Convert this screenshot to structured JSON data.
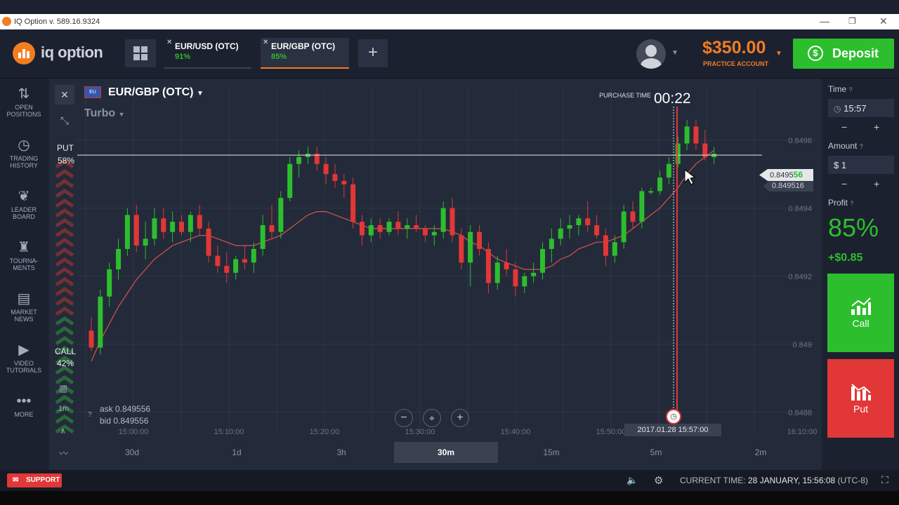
{
  "window": {
    "title": "IQ Option v. 589.16.9324",
    "minimize": "—",
    "restore": "❐",
    "close": "✕"
  },
  "header": {
    "logo_text": "iq option",
    "tabs": [
      {
        "name": "EUR/USD (OTC)",
        "pct": "91%",
        "close": "✕"
      },
      {
        "name": "EUR/GBP (OTC)",
        "pct": "85%",
        "close": "✕"
      }
    ],
    "add_tab": "+",
    "balance": "$350.00",
    "account_type": "PRACTICE ACCOUNT",
    "deposit": "Deposit"
  },
  "nav": [
    {
      "label1": "OPEN",
      "label2": "POSITIONS",
      "icon": "sort-arrows-icon"
    },
    {
      "label1": "TRADING",
      "label2": "HISTORY",
      "icon": "history-icon"
    },
    {
      "label1": "LEADER",
      "label2": "BOARD",
      "icon": "leader-icon"
    },
    {
      "label1": "TOURNA-",
      "label2": "MENTS",
      "icon": "trophy-icon"
    },
    {
      "label1": "MARKET",
      "label2": "NEWS",
      "icon": "news-icon"
    },
    {
      "label1": "VIDEO",
      "label2": "TUTORIALS",
      "icon": "play-icon"
    },
    {
      "label1": "MORE",
      "label2": "",
      "icon": "dots-icon"
    }
  ],
  "chart": {
    "asset": "EUR/GBP (OTC)",
    "mode": "Turbo",
    "purchase_label": "PURCHASE TIME",
    "purchase_countdown": "00:22",
    "put_label": "PUT",
    "put_pct": "58%",
    "call_label": "CALL",
    "call_pct": "42%",
    "interval": "1m",
    "ask": "ask 0.849556",
    "bid": "bid 0.849556",
    "price_tag_main": "0.8495",
    "price_tag_hi": "56",
    "price_tag_prev": "0.849516",
    "expiry_label": "2017.01.28 15:57:00",
    "time_axis": [
      "15:00:00",
      "15:10:00",
      "15:20:00",
      "15:30:00",
      "15:40:00",
      "15:50:00",
      "16:00:00",
      "16:10:00"
    ],
    "price_axis": [
      "0.8496",
      "0.8494",
      "0.8492",
      "0.849",
      "0.8488"
    ],
    "timeframes": [
      "30d",
      "1d",
      "3h",
      "30m",
      "15m",
      "5m",
      "2m"
    ],
    "active_timeframe": "30m"
  },
  "chart_data": {
    "type": "candlestick",
    "ylim": [
      0.84875,
      0.84975
    ],
    "candles": [
      [
        0.84904,
        0.84908,
        0.84898,
        0.84899
      ],
      [
        0.84899,
        0.84916,
        0.84897,
        0.84914
      ],
      [
        0.84914,
        0.84924,
        0.84911,
        0.84922
      ],
      [
        0.84922,
        0.84931,
        0.84919,
        0.84928
      ],
      [
        0.84928,
        0.8494,
        0.84926,
        0.84938
      ],
      [
        0.84938,
        0.84941,
        0.84927,
        0.84929
      ],
      [
        0.84929,
        0.84936,
        0.84925,
        0.84931
      ],
      [
        0.84931,
        0.8494,
        0.84929,
        0.84937
      ],
      [
        0.84937,
        0.8494,
        0.84931,
        0.84933
      ],
      [
        0.84933,
        0.84939,
        0.8493,
        0.84936
      ],
      [
        0.84936,
        0.84938,
        0.84932,
        0.84933
      ],
      [
        0.84933,
        0.84939,
        0.8493,
        0.84938
      ],
      [
        0.84938,
        0.84941,
        0.84932,
        0.84934
      ],
      [
        0.84934,
        0.84936,
        0.84924,
        0.84926
      ],
      [
        0.84926,
        0.84929,
        0.84921,
        0.84923
      ],
      [
        0.84923,
        0.84927,
        0.84918,
        0.84921
      ],
      [
        0.84921,
        0.84926,
        0.84919,
        0.84925
      ],
      [
        0.84925,
        0.84929,
        0.84922,
        0.84924
      ],
      [
        0.84924,
        0.8493,
        0.84921,
        0.84928
      ],
      [
        0.84928,
        0.84938,
        0.84926,
        0.84935
      ],
      [
        0.84935,
        0.84941,
        0.84931,
        0.84933
      ],
      [
        0.84933,
        0.84945,
        0.84931,
        0.84943
      ],
      [
        0.84943,
        0.84955,
        0.84942,
        0.84953
      ],
      [
        0.84953,
        0.84957,
        0.84949,
        0.84955
      ],
      [
        0.84955,
        0.84958,
        0.84953,
        0.84956
      ],
      [
        0.84956,
        0.84958,
        0.84951,
        0.84953
      ],
      [
        0.84953,
        0.84955,
        0.84947,
        0.8495
      ],
      [
        0.8495,
        0.84953,
        0.84946,
        0.84948
      ],
      [
        0.84948,
        0.8495,
        0.84943,
        0.84947
      ],
      [
        0.84947,
        0.84949,
        0.84934,
        0.84936
      ],
      [
        0.84936,
        0.84938,
        0.84929,
        0.84932
      ],
      [
        0.84932,
        0.84937,
        0.8493,
        0.84935
      ],
      [
        0.84935,
        0.84937,
        0.84931,
        0.84933
      ],
      [
        0.84933,
        0.84937,
        0.84932,
        0.84936
      ],
      [
        0.84936,
        0.84939,
        0.84932,
        0.84934
      ],
      [
        0.84934,
        0.84937,
        0.84931,
        0.84935
      ],
      [
        0.84935,
        0.84938,
        0.84933,
        0.84934
      ],
      [
        0.84934,
        0.84935,
        0.8493,
        0.84932
      ],
      [
        0.84932,
        0.84935,
        0.84929,
        0.84933
      ],
      [
        0.84933,
        0.84942,
        0.84931,
        0.8494
      ],
      [
        0.8494,
        0.84943,
        0.8493,
        0.84932
      ],
      [
        0.84932,
        0.84934,
        0.84922,
        0.84924
      ],
      [
        0.84924,
        0.84935,
        0.84917,
        0.84933
      ],
      [
        0.84933,
        0.84935,
        0.84926,
        0.84928
      ],
      [
        0.84928,
        0.8493,
        0.84915,
        0.84918
      ],
      [
        0.84918,
        0.84926,
        0.84916,
        0.84924
      ],
      [
        0.84924,
        0.84928,
        0.8492,
        0.84922
      ],
      [
        0.84922,
        0.84924,
        0.84914,
        0.84917
      ],
      [
        0.84917,
        0.84921,
        0.84915,
        0.8492
      ],
      [
        0.8492,
        0.84924,
        0.84918,
        0.84921
      ],
      [
        0.84921,
        0.8493,
        0.84919,
        0.84928
      ],
      [
        0.84928,
        0.84934,
        0.84924,
        0.84931
      ],
      [
        0.84931,
        0.84937,
        0.84929,
        0.84934
      ],
      [
        0.84934,
        0.84938,
        0.84931,
        0.84935
      ],
      [
        0.84935,
        0.84938,
        0.84932,
        0.84937
      ],
      [
        0.84937,
        0.84942,
        0.84933,
        0.84935
      ],
      [
        0.84935,
        0.84938,
        0.84931,
        0.84932
      ],
      [
        0.84932,
        0.84934,
        0.84923,
        0.84926
      ],
      [
        0.84926,
        0.84932,
        0.84924,
        0.8493
      ],
      [
        0.8493,
        0.84941,
        0.84928,
        0.84939
      ],
      [
        0.84939,
        0.84942,
        0.84934,
        0.84936
      ],
      [
        0.84936,
        0.84946,
        0.84934,
        0.84945
      ],
      [
        0.84945,
        0.84946,
        0.84944,
        0.84945
      ],
      [
        0.84945,
        0.84951,
        0.84944,
        0.84949
      ],
      [
        0.84949,
        0.84955,
        0.84947,
        0.84953
      ],
      [
        0.84953,
        0.84961,
        0.84952,
        0.84959
      ],
      [
        0.84959,
        0.84966,
        0.84957,
        0.84964
      ],
      [
        0.84964,
        0.84966,
        0.84957,
        0.84959
      ],
      [
        0.84959,
        0.84963,
        0.84954,
        0.84955
      ],
      [
        0.84955,
        0.84958,
        0.84953,
        0.84956
      ]
    ],
    "ma": [
      0.84895,
      0.84901,
      0.84906,
      0.84911,
      0.84915,
      0.84919,
      0.84922,
      0.84925,
      0.84927,
      0.84929,
      0.8493,
      0.84931,
      0.84932,
      0.84932,
      0.84931,
      0.8493,
      0.84929,
      0.84929,
      0.84929,
      0.8493,
      0.84931,
      0.84932,
      0.84934,
      0.84936,
      0.84938,
      0.84939,
      0.84939,
      0.84938,
      0.84937,
      0.84936,
      0.84935,
      0.84934,
      0.84934,
      0.84934,
      0.84934,
      0.84934,
      0.84934,
      0.84934,
      0.84934,
      0.84934,
      0.84933,
      0.84932,
      0.8493,
      0.84929,
      0.84927,
      0.84925,
      0.84924,
      0.84923,
      0.84922,
      0.84922,
      0.84922,
      0.84923,
      0.84925,
      0.84926,
      0.84928,
      0.84929,
      0.8493,
      0.8493,
      0.84931,
      0.84932,
      0.84934,
      0.84936,
      0.84938,
      0.8494,
      0.84943,
      0.84946,
      0.8495,
      0.84953,
      0.84955,
      0.84957
    ],
    "current_price": 0.849556
  },
  "right": {
    "time_label": "Time",
    "time_value": "15:57",
    "amount_label": "Amount",
    "amount_value": "$ 1",
    "profit_label": "Profit",
    "profit_pct": "85%",
    "profit_value": "+$0.85",
    "call": "Call",
    "put": "Put",
    "minus": "−",
    "plus": "+"
  },
  "footer": {
    "support": "SUPPORT",
    "current_time_label": "CURRENT TIME:",
    "current_time": "28 JANUARY, 15:56:08",
    "tz": "(UTC-8)"
  },
  "colors": {
    "accent": "#f27d21",
    "green": "#2dbe2d",
    "red": "#e23737",
    "bg": "#1c2130",
    "chart_bg": "#232a3a"
  }
}
